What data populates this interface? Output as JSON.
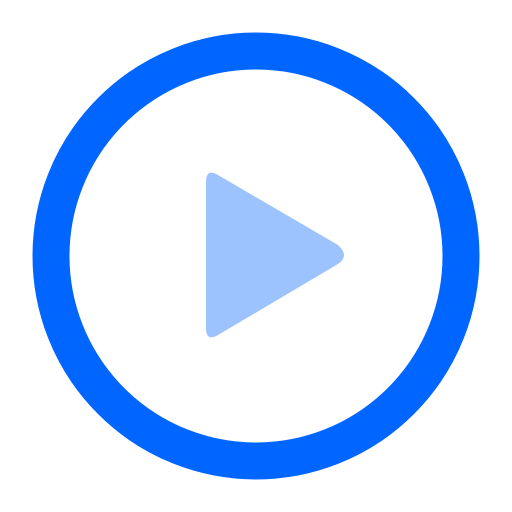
{
  "icon": {
    "name": "play-circle-icon",
    "ring_color": "#0066FF",
    "triangle_color": "#9DC3FF",
    "background": "#FFFFFF"
  }
}
